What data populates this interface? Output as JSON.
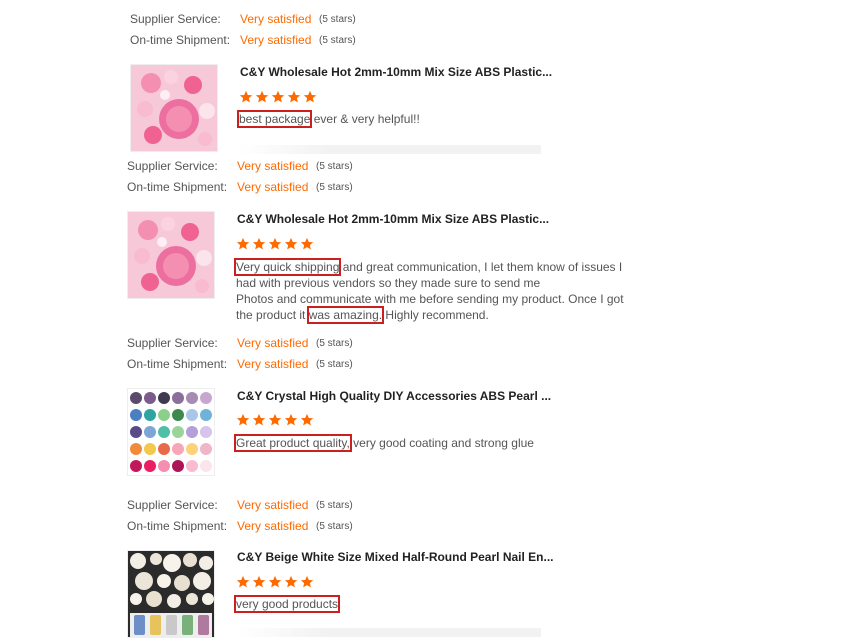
{
  "labels": {
    "supplier": "Supplier Service:",
    "shipment": "On-time Shipment:"
  },
  "ratings": [
    {
      "supplier_value": "Very satisfied",
      "supplier_stars": "(5 stars)",
      "shipment_value": "Very satisfied",
      "shipment_stars": "(5 stars)"
    },
    {
      "supplier_value": "Very satisfied",
      "supplier_stars": "(5 stars)",
      "shipment_value": "Very satisfied",
      "shipment_stars": "(5 stars)"
    },
    {
      "supplier_value": "Very satisfied",
      "supplier_stars": "(5 stars)",
      "shipment_value": "Very satisfied",
      "shipment_stars": "(5 stars)"
    },
    {
      "supplier_value": "Very satisfied",
      "supplier_stars": "(5 stars)",
      "shipment_value": "Very satisfied",
      "shipment_stars": "(5 stars)"
    }
  ],
  "reviews": [
    {
      "product_title": "C&Y Wholesale Hot 2mm-10mm Mix Size ABS Plastic...",
      "stars": 5,
      "highlight": "best package",
      "text_after": " ever & very helpful!!",
      "thumb": "pink-pearls"
    },
    {
      "product_title": "C&Y Wholesale Hot 2mm-10mm Mix Size ABS Plastic...",
      "stars": 5,
      "highlight_1": "Very quick shipping",
      "text_1": " and great communication, I let them know of issues I had with previous vendors so they made sure to send me",
      "text_2": "Photos and communicate with me before sending my product. Once I got the product it ",
      "highlight_2": "was amazing.",
      "text_3": " Highly recommend.",
      "thumb": "pink-pearls"
    },
    {
      "product_title": "C&Y Crystal High Quality DIY Accessories ABS Pearl ...",
      "stars": 5,
      "highlight": "Great product quality,",
      "text_after": " very good coating and strong glue",
      "thumb": "color-pearls"
    },
    {
      "product_title": "C&Y Beige White Size Mixed Half-Round Pearl Nail En...",
      "stars": 5,
      "highlight": "very good products",
      "text_after": "",
      "thumb": "white-pearls"
    }
  ],
  "colors": {
    "accent": "#ff6a00",
    "highlight_box": "#cc1f1f",
    "star": "#ff6a00"
  }
}
